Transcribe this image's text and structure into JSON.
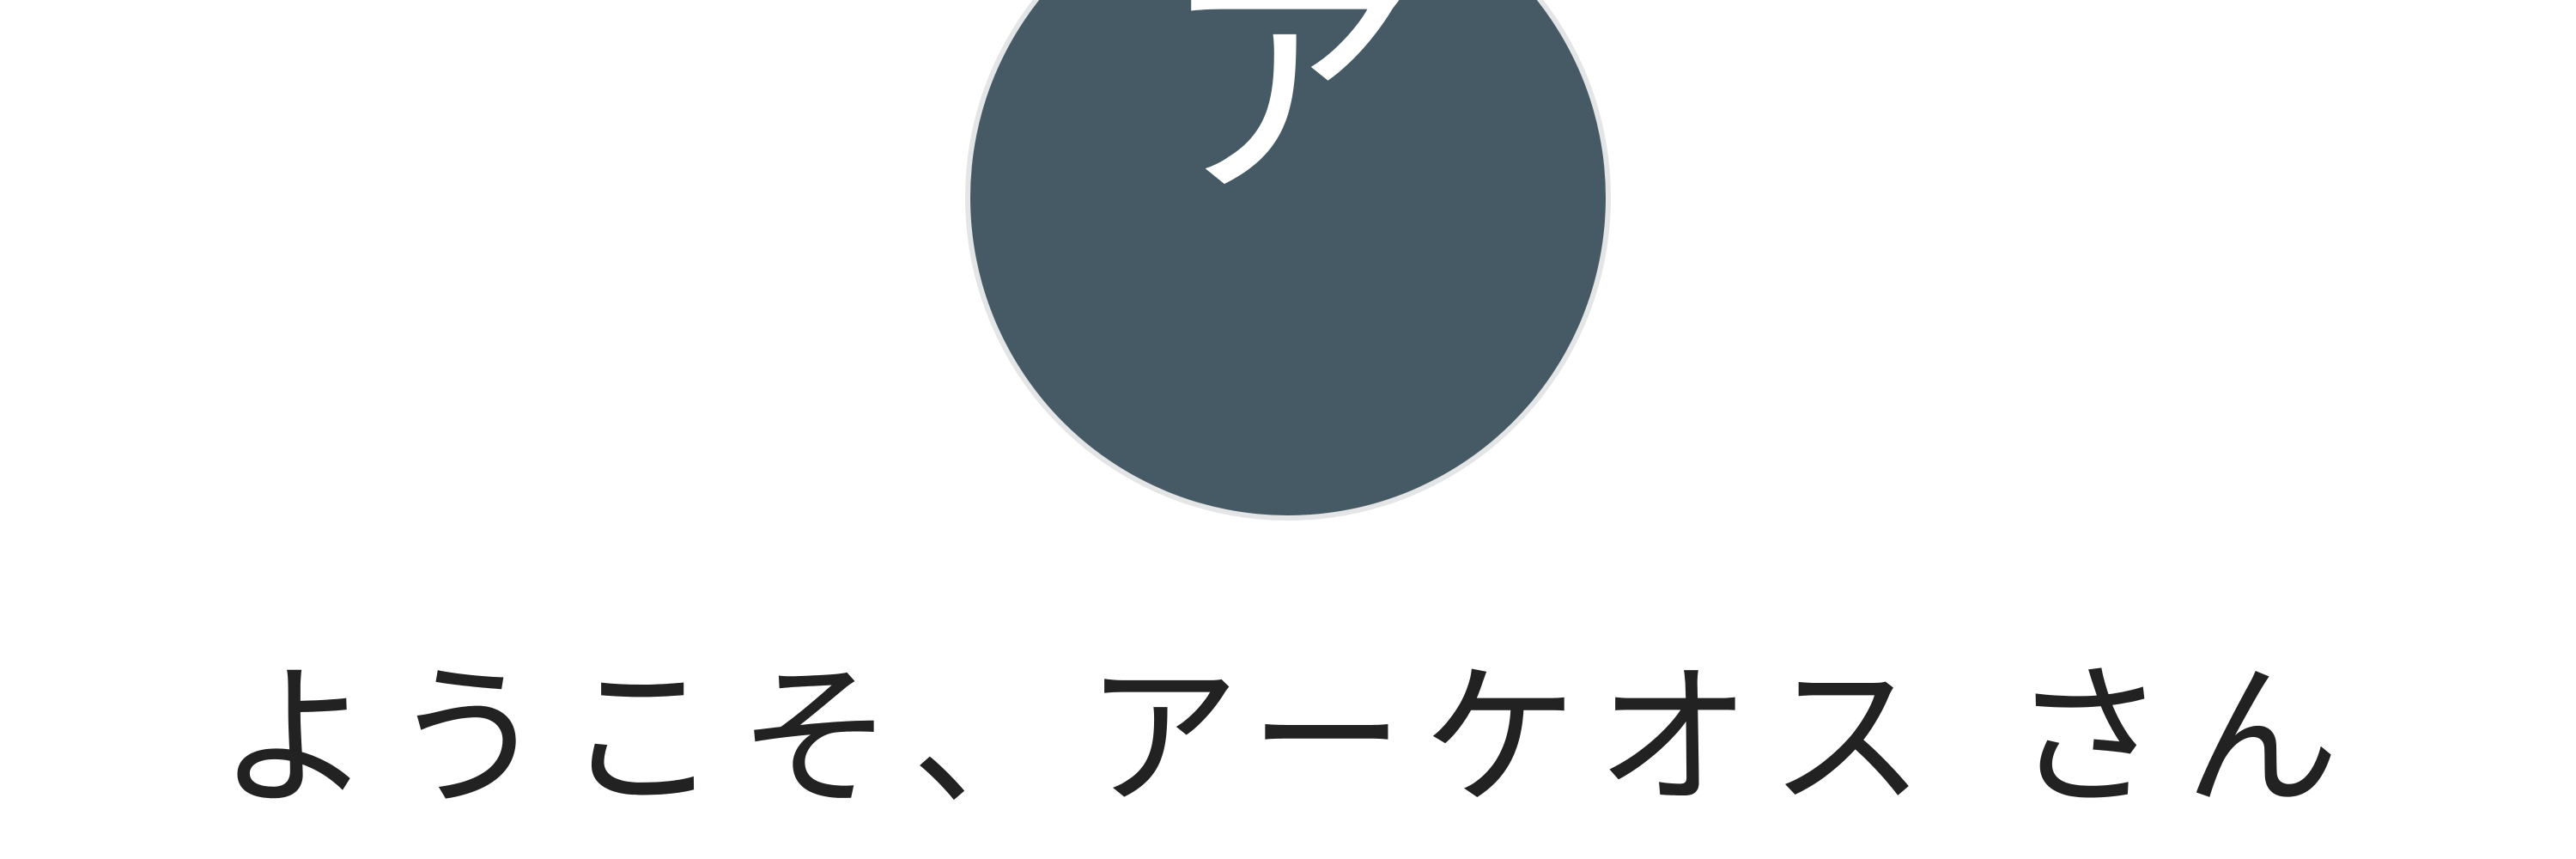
{
  "avatar": {
    "initial": "ア",
    "background_color": "#455a64",
    "border_color": "#e3e5e6"
  },
  "welcome": {
    "text": "ようこそ、アーケオス さん"
  }
}
